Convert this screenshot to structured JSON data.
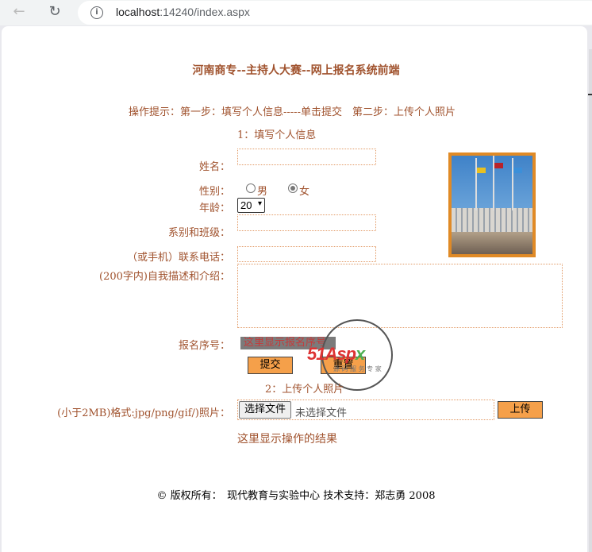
{
  "browser": {
    "url_host": "localhost",
    "url_port_path": ":14240/index.aspx"
  },
  "title": "河南商专--主持人大赛--网上报名系统前端",
  "hint": "操作提示：第一步：填写个人信息-----单击提交　第二步：上传个人照片",
  "step1": "1：填写个人信息",
  "form": {
    "name_label": "姓名：",
    "gender_label": "性别：",
    "gender_options": [
      "男",
      "女"
    ],
    "gender_selected": "女",
    "age_label": "年龄：",
    "age_value": "20",
    "class_label": "系别和班级：",
    "phone_label": "（或手机）联系电话：",
    "intro_label": "(200字内)自我描述和介绍：",
    "serial_label": "报名序号：",
    "serial_value": "这里显示报名序号",
    "submit_label": "提交",
    "reset_label": "重置"
  },
  "step2": "2：上传个人照片",
  "upload": {
    "photo_label": "(小于2MB)格式:jpg/png/gif/)照片：",
    "choose_label": "选择文件",
    "file_status": "未选择文件",
    "upload_label": "上传",
    "result_text": "这里显示操作的结果"
  },
  "watermark": {
    "text_red": "51",
    "text_red2": "Asp",
    "text_green": "x",
    "sub": "源 码 服 务 专 家"
  },
  "footer": "© 版权所有：　现代教育与实验中心 技术支持：郑志勇 2008",
  "colors": {
    "label": "#a0522d",
    "button": "#f5a04a",
    "photo_frame": "#e08a26"
  }
}
